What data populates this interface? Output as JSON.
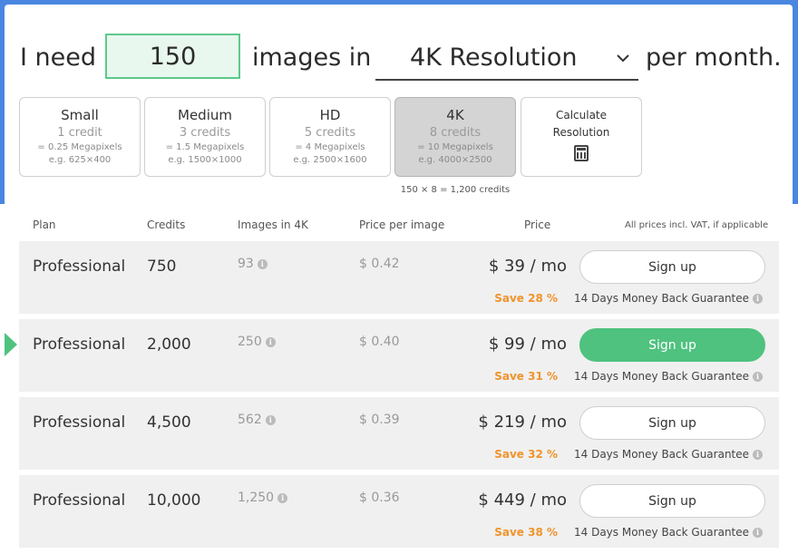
{
  "sentence": {
    "prefix": "I need",
    "quantity": "150",
    "middle": "images in",
    "resolution": "4K Resolution",
    "suffix": "per month."
  },
  "options": [
    {
      "name": "Small",
      "credits": "1 credit",
      "mp": "= 0.25 Megapixels",
      "eg": "e.g. 625×400",
      "selected": false
    },
    {
      "name": "Medium",
      "credits": "3 credits",
      "mp": "= 1.5 Megapixels",
      "eg": "e.g. 1500×1000",
      "selected": false
    },
    {
      "name": "HD",
      "credits": "5 credits",
      "mp": "= 4 Megapixels",
      "eg": "e.g. 2500×1600",
      "selected": false
    },
    {
      "name": "4K",
      "credits": "8 credits",
      "mp": "= 10 Megapixels",
      "eg": "e.g. 4000×2500",
      "selected": true
    }
  ],
  "calculate": {
    "line1": "Calculate",
    "line2": "Resolution",
    "icon": "calculator-icon"
  },
  "formula": "150 × 8 = 1,200 credits",
  "table": {
    "headers": {
      "plan": "Plan",
      "credits": "Credits",
      "images": "Images in 4K",
      "ppi": "Price per image",
      "price": "Price",
      "note": "All prices incl. VAT, if applicable"
    },
    "rows": [
      {
        "plan": "Professional",
        "credits": "750",
        "images": "93",
        "ppi": "$ 0.42",
        "price": "$ 39 / mo",
        "save": "Save 28 %",
        "button": "Sign up",
        "guarantee": "14 Days Money Back Guarantee",
        "highlight": false
      },
      {
        "plan": "Professional",
        "credits": "2,000",
        "images": "250",
        "ppi": "$ 0.40",
        "price": "$ 99 / mo",
        "save": "Save 31 %",
        "button": "Sign up",
        "guarantee": "14 Days Money Back Guarantee",
        "highlight": true
      },
      {
        "plan": "Professional",
        "credits": "4,500",
        "images": "562",
        "ppi": "$ 0.39",
        "price": "$ 219 / mo",
        "save": "Save 32 %",
        "button": "Sign up",
        "guarantee": "14 Days Money Back Guarantee",
        "highlight": false
      },
      {
        "plan": "Professional",
        "credits": "10,000",
        "images": "1,250",
        "ppi": "$ 0.36",
        "price": "$ 449 / mo",
        "save": "Save 38 %",
        "button": "Sign up",
        "guarantee": "14 Days Money Back Guarantee",
        "highlight": false
      }
    ]
  },
  "colors": {
    "accent": "#4fc27f",
    "save": "#f0932b",
    "header_bg": "#4a86e0"
  }
}
